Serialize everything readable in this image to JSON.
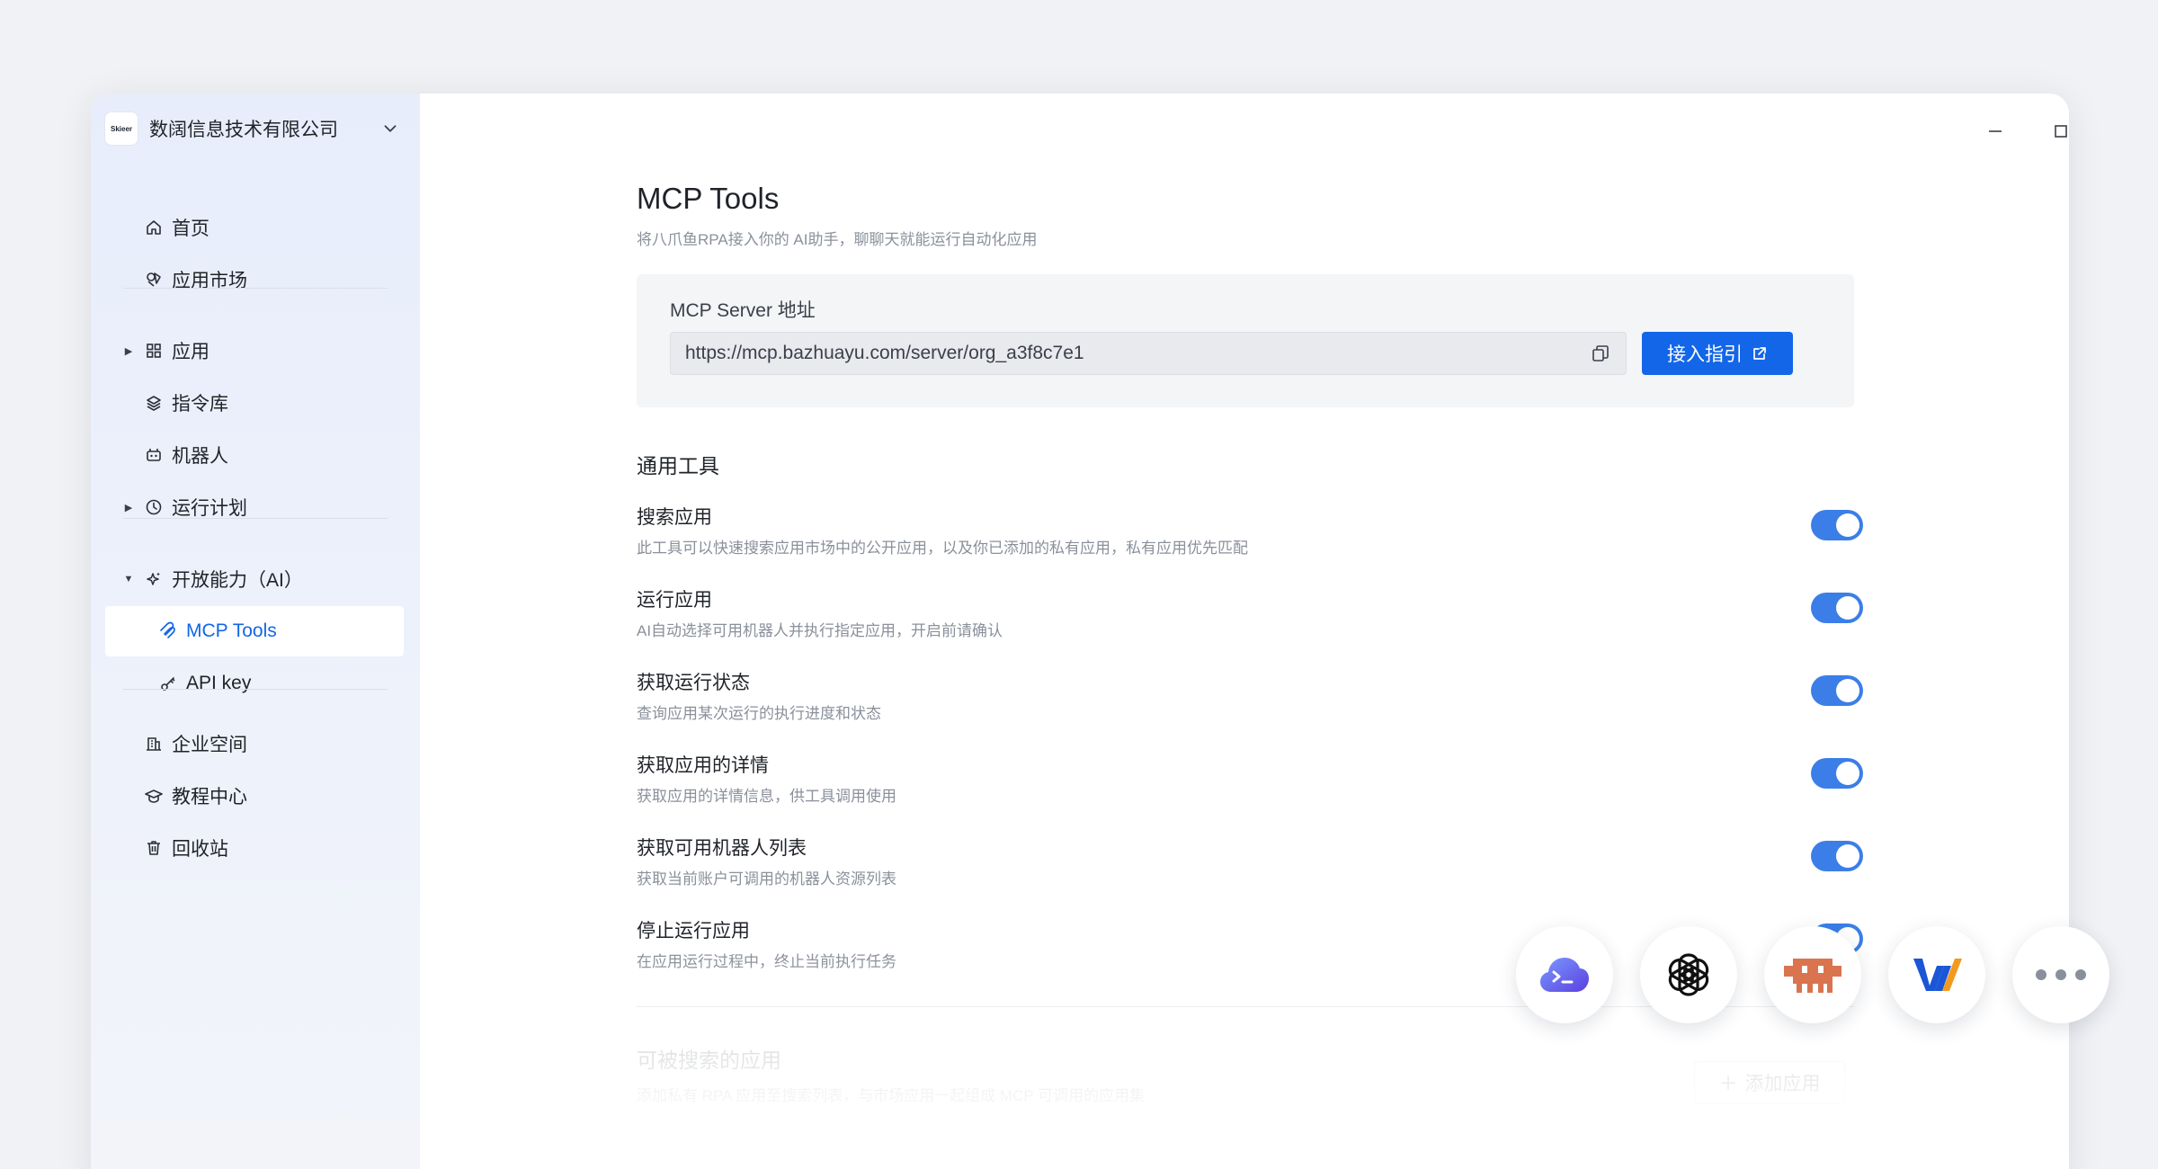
{
  "org": {
    "logo_text": "Skieer",
    "name": "数阔信息技术有限公司"
  },
  "nav": {
    "home": "首页",
    "market": "应用市场",
    "apps": "应用",
    "commands": "指令库",
    "robots": "机器人",
    "schedule": "运行计划",
    "open_ai": "开放能力（AI）",
    "mcp_tools": "MCP Tools",
    "api_key": "API key",
    "enterprise": "企业空间",
    "tutorials": "教程中心",
    "recycle": "回收站"
  },
  "page": {
    "title": "MCP Tools",
    "subtitle": "将八爪鱼RPA接入你的 AI助手，聊聊天就能运行自动化应用"
  },
  "server": {
    "label": "MCP Server 地址",
    "url": "https://mcp.bazhuayu.com/server/org_a3f8c7e1",
    "guide_label": "接入指引"
  },
  "tools_section": {
    "title": "通用工具",
    "items": [
      {
        "name": "搜索应用",
        "desc": "此工具可以快速搜索应用市场中的公开应用，以及你已添加的私有应用，私有应用优先匹配",
        "enabled": true
      },
      {
        "name": "运行应用",
        "desc": "AI自动选择可用机器人并执行指定应用，开启前请确认",
        "enabled": true
      },
      {
        "name": "获取运行状态",
        "desc": "查询应用某次运行的执行进度和状态",
        "enabled": true
      },
      {
        "name": "获取应用的详情",
        "desc": "获取应用的详情信息，供工具调用使用",
        "enabled": true
      },
      {
        "name": "获取可用机器人列表",
        "desc": "获取当前账户可调用的机器人资源列表",
        "enabled": true
      },
      {
        "name": "停止运行应用",
        "desc": "在应用运行过程中，终止当前执行任务",
        "enabled": true
      }
    ]
  },
  "searchable": {
    "title": "可被搜索的应用",
    "desc": "添加私有 RPA 应用至搜索列表，与市场应用一起组成 MCP 可调用的应用集",
    "add_label": "添加应用"
  },
  "clients": [
    "terminal-cloud-icon",
    "openai-icon",
    "robot-invader-icon",
    "w-logo-icon",
    "more-icon"
  ],
  "colors": {
    "accent": "#1366e8",
    "toggle_on": "#3b7ee8",
    "sidebar_bg": "#e7edfb"
  }
}
